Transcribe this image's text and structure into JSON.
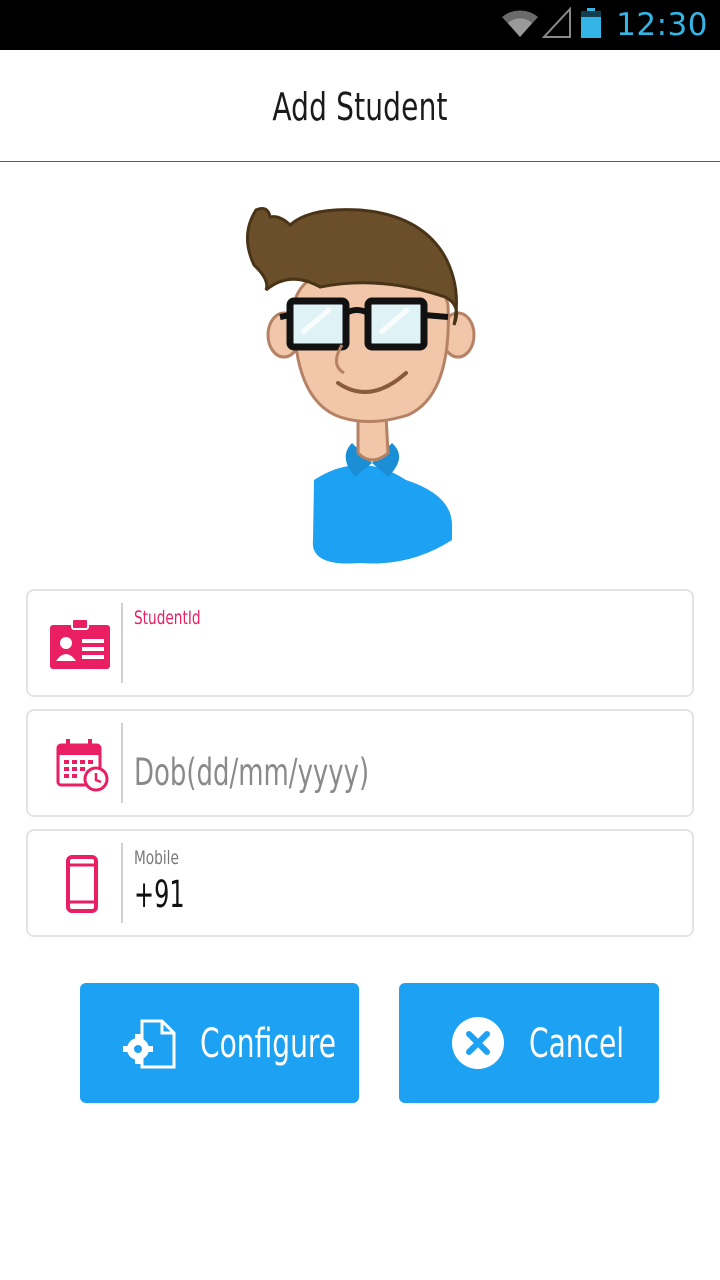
{
  "status_bar": {
    "time": "12:30",
    "icons": [
      "wifi-icon",
      "signal-icon",
      "battery-icon"
    ],
    "time_color": "#33b5e5"
  },
  "header": {
    "title": "Add Student",
    "divider_color": "#d81b60"
  },
  "form": {
    "student_id": {
      "label": "StudentId",
      "value": "",
      "icon": "id-card-icon"
    },
    "dob": {
      "placeholder": "Dob(dd/mm/yyyy)",
      "icon": "calendar-clock-icon"
    },
    "mobile": {
      "label": "Mobile",
      "value": "+91",
      "icon": "phone-icon"
    }
  },
  "buttons": {
    "configure": {
      "label": "Configure",
      "icon": "document-gear-icon"
    },
    "cancel": {
      "label": "Cancel",
      "icon": "close-circle-icon"
    }
  },
  "colors": {
    "accent": "#e91e63",
    "button": "#1da1f2"
  }
}
